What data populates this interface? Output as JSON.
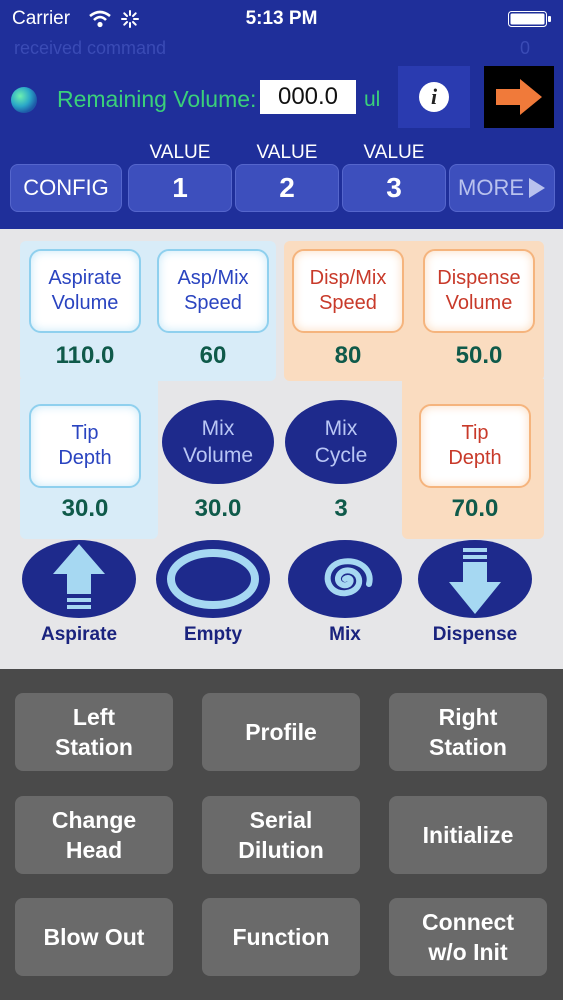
{
  "status_bar": {
    "carrier": "Carrier",
    "time": "5:13 PM"
  },
  "header": {
    "received_command": "received command",
    "counter": "0",
    "remaining_volume_label": "Remaining Volume:",
    "remaining_volume_value": "000.0",
    "volume_unit": "ul"
  },
  "value_header": "VALUE",
  "top_buttons": {
    "config": "CONFIG",
    "v1": "1",
    "v2": "2",
    "v3": "3",
    "more": "MORE"
  },
  "params": {
    "aspirate_volume": {
      "label": "Aspirate\nVolume",
      "value": "110.0"
    },
    "asp_mix_speed": {
      "label": "Asp/Mix\nSpeed",
      "value": "60"
    },
    "disp_mix_speed": {
      "label": "Disp/Mix\nSpeed",
      "value": "80"
    },
    "dispense_volume": {
      "label": "Dispense\nVolume",
      "value": "50.0"
    },
    "tip_depth_left": {
      "label": "Tip\nDepth",
      "value": "30.0"
    },
    "mix_volume": {
      "label": "Mix\nVolume",
      "value": "30.0"
    },
    "mix_cycle": {
      "label": "Mix\nCycle",
      "value": "3"
    },
    "tip_depth_right": {
      "label": "Tip\nDepth",
      "value": "70.0"
    }
  },
  "actions": {
    "aspirate": "Aspirate",
    "empty": "Empty",
    "mix": "Mix",
    "dispense": "Dispense"
  },
  "grid_buttons": {
    "left_station": "Left\nStation",
    "profile": "Profile",
    "right_station": "Right\nStation",
    "change_head": "Change\nHead",
    "serial_dilution": "Serial\nDilution",
    "initialize": "Initialize",
    "blow_out": "Blow Out",
    "function": "Function",
    "connect_wo_init": "Connect\nw/o Init"
  },
  "colors": {
    "header_bg": "#1f2f9a",
    "accent_green": "#3ad07a",
    "aspirate_zone": "#d8ecf8",
    "dispense_zone": "#fadcc0",
    "oval_fill": "#1e2a8c",
    "grid_button": "#6a6a6a"
  },
  "icons": {
    "wifi": "wifi-icon",
    "activity": "activity-spinner-icon",
    "battery": "battery-icon",
    "status_dot": "status-dot-icon",
    "info": "info-icon",
    "next": "arrow-right-icon",
    "more": "play-triangle-icon"
  }
}
